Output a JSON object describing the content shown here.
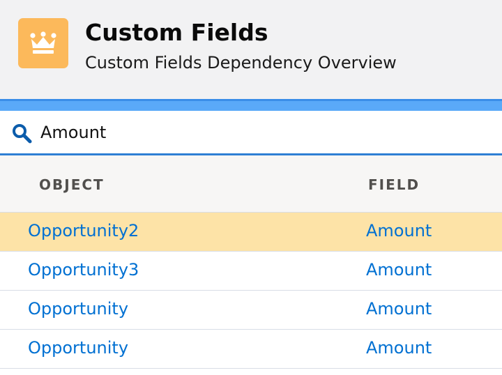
{
  "header": {
    "icon": "crown-icon",
    "icon_color": "#fcb95b",
    "title": "Custom Fields",
    "subtitle": "Custom Fields Dependency Overview"
  },
  "accent_color": "#5aa9f8",
  "search": {
    "icon": "search-icon",
    "value": "Amount"
  },
  "table": {
    "columns": [
      "OBJECT",
      "FIELD"
    ],
    "selected_row_color": "#fde3a7",
    "link_color": "#0070d2",
    "rows": [
      {
        "object": "Opportunity2",
        "field": "Amount",
        "selected": true
      },
      {
        "object": "Opportunity3",
        "field": "Amount",
        "selected": false
      },
      {
        "object": "Opportunity",
        "field": "Amount",
        "selected": false
      },
      {
        "object": "Opportunity",
        "field": "Amount",
        "selected": false
      }
    ]
  }
}
